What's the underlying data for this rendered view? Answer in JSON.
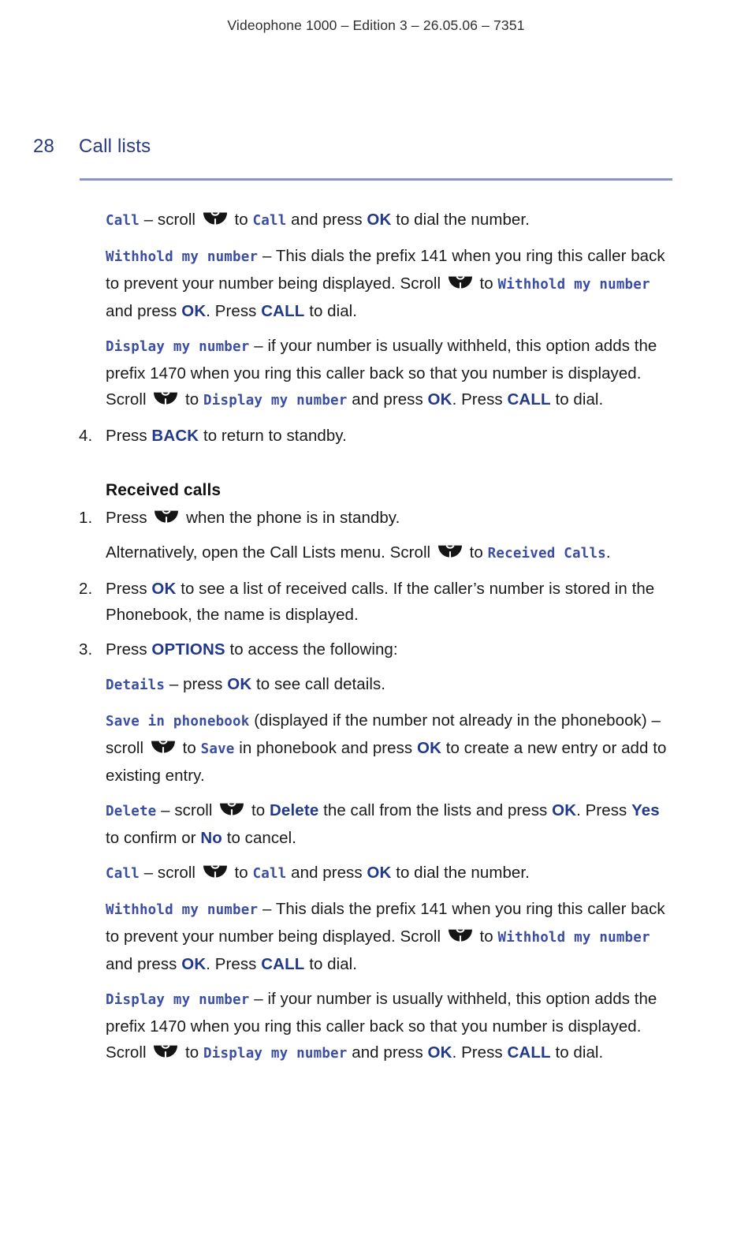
{
  "header": {
    "running_head": "Videophone 1000 – Edition 3 – 26.05.06 – 7351"
  },
  "title": {
    "page_number": "28",
    "chapter": "Call lists"
  },
  "icons": {
    "nav_key": "navigation-scroll-key-icon"
  },
  "keys": {
    "ok": "OK",
    "call": "CALL",
    "back": "BACK",
    "options": "OPTIONS",
    "delete": "Delete",
    "yes": "Yes",
    "no": "No"
  },
  "display_terms": {
    "call": "Call",
    "withhold_my_number": "Withhold my number",
    "display_my_number": "Display my number",
    "received_calls": "Received Calls",
    "details": "Details",
    "save_in_phonebook": "Save in phonebook",
    "save": "Save",
    "delete": "Delete"
  },
  "body": {
    "call_paragraph": {
      "term": "Call",
      "t1": " – scroll ",
      "t2": " to ",
      "term2": "Call",
      "t3": " and press ",
      "key": "OK",
      "t4": " to dial the number."
    },
    "withhold_paragraph": {
      "term": "Withhold my number",
      "t1": " – This dials the prefix 141 when you ring this caller back to prevent your number being displayed. Scroll ",
      "t2": " to ",
      "term2": "Withhold my number",
      "t3": " and press ",
      "key1": "OK",
      "t4": ". Press ",
      "key2": "CALL",
      "t5": " to dial."
    },
    "display_paragraph": {
      "term": "Display my number",
      "t1": " – if your number is usually withheld, this option adds the prefix 1470 when you ring this caller back so that you number is displayed. Scroll ",
      "t2": " to ",
      "term2": "Display my number",
      "t3": " and press ",
      "key1": "OK",
      "t4": ". Press ",
      "key2": "CALL",
      "t5": " to dial."
    },
    "step4": {
      "num": "4.",
      "t1": "Press ",
      "key": "BACK",
      "t2": " to return to standby."
    },
    "received_calls_heading": "Received calls",
    "step1": {
      "num": "1.",
      "t1": "Press ",
      "t2": " when the phone is in standby."
    },
    "step1_alt": {
      "t1": "Alternatively, open the Call Lists menu. Scroll ",
      "t2": " to ",
      "term": "Received Calls",
      "t3": "."
    },
    "step2": {
      "num": "2.",
      "t1": "Press ",
      "key": "OK",
      "t2": " to see a list of received calls. If the caller’s number is stored in the Phonebook, the name is displayed."
    },
    "step3": {
      "num": "3.",
      "t1": "Press ",
      "key": "OPTIONS",
      "t2": " to access the following:"
    },
    "details_paragraph": {
      "term": "Details",
      "t1": " – press ",
      "key": "OK",
      "t2": " to see call details."
    },
    "save_paragraph": {
      "term": "Save in phonebook",
      "t1": " (displayed if the number not already in the phonebook) – scroll ",
      "t2": " to ",
      "term2": "Save",
      "t3": " in phonebook and press ",
      "key": "OK",
      "t4": " to create a new entry or add to existing entry."
    },
    "delete_paragraph": {
      "term": "Delete",
      "t1": " – scroll ",
      "t2": " to ",
      "key1": "Delete",
      "t3": " the call from the lists and press ",
      "key2": "OK",
      "t4": ". Press ",
      "key3": "Yes",
      "t5": " to confirm or ",
      "key4": "No",
      "t6": " to cancel."
    },
    "call_paragraph_2": {
      "term": "Call",
      "t1": " – scroll ",
      "t2": " to ",
      "term2": "Call",
      "t3": " and press ",
      "key": "OK",
      "t4": " to dial the number."
    },
    "withhold_paragraph_2": {
      "term": "Withhold my number",
      "t1": " – This dials the prefix 141 when you ring this caller back to prevent your number being displayed. Scroll ",
      "t2": " to ",
      "term2": "Withhold my number",
      "t3": " and press ",
      "key1": "OK",
      "t4": ". Press ",
      "key2": "CALL",
      "t5": " to dial."
    },
    "display_paragraph_2": {
      "term": "Display my number",
      "t1": " – if your number is usually withheld, this option adds the prefix 1470 when you ring this caller back so that you number is displayed. Scroll ",
      "t2": " to ",
      "term2": "Display my number",
      "t3": " and press ",
      "key1": "OK",
      "t4": ". Press ",
      "key2": "CALL",
      "t5": " to dial."
    }
  },
  "colors": {
    "heading_blue": "#283a7d",
    "rule_blue": "#8d92c9",
    "key_blue": "#22398a",
    "lcd_blue": "#3a4da3",
    "body_black": "#1a1a1a"
  }
}
